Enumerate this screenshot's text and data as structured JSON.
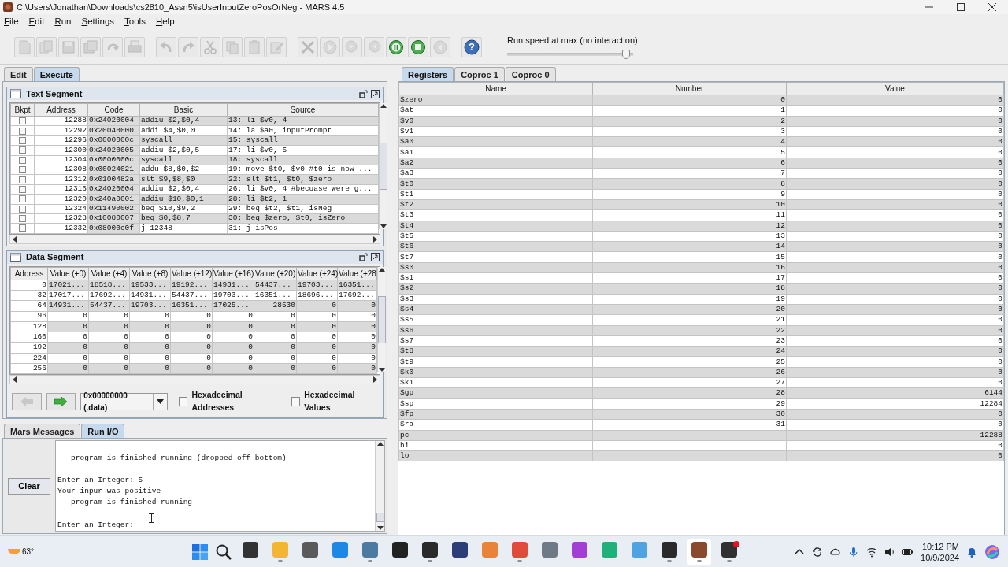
{
  "window": {
    "title": "C:\\Users\\Jonathan\\Downloads\\cs2810_Assn5\\isUserInputZeroPosOrNeg  - MARS 4.5"
  },
  "menu": [
    "File",
    "Edit",
    "Run",
    "Settings",
    "Tools",
    "Help"
  ],
  "toolbar": {
    "groups": [
      [
        {
          "kind": "new",
          "disabled": true
        },
        {
          "kind": "open",
          "disabled": true
        },
        {
          "kind": "save",
          "disabled": true
        },
        {
          "kind": "save_as",
          "disabled": true
        },
        {
          "kind": "dump",
          "disabled": true
        },
        {
          "kind": "print",
          "disabled": true
        }
      ],
      [
        {
          "kind": "undo",
          "disabled": true
        },
        {
          "kind": "redo",
          "disabled": true
        },
        {
          "kind": "cut",
          "disabled": true
        },
        {
          "kind": "copy",
          "disabled": true
        },
        {
          "kind": "paste",
          "disabled": true
        },
        {
          "kind": "find",
          "disabled": true
        }
      ],
      [
        {
          "kind": "assemble",
          "disabled": true
        },
        {
          "kind": "go",
          "disabled": true
        },
        {
          "kind": "step",
          "disabled": true
        },
        {
          "kind": "backstep",
          "disabled": true
        },
        {
          "kind": "pause",
          "disabled": false
        },
        {
          "kind": "stop",
          "disabled": false
        },
        {
          "kind": "reset",
          "disabled": true
        }
      ],
      [
        {
          "kind": "help",
          "disabled": false,
          "glyph": "?"
        }
      ]
    ],
    "speed": {
      "label": "Run speed at max (no interaction)",
      "level": 0.97
    }
  },
  "left_tabs": [
    {
      "label": "Edit",
      "selected": false
    },
    {
      "label": "Execute",
      "selected": true
    }
  ],
  "text_segment": {
    "title": "Text Segment",
    "columns": [
      "Bkpt",
      "Address",
      "Code",
      "Basic",
      "Source"
    ],
    "rows": [
      {
        "bkpt": false,
        "address": "12288",
        "code": "0x24020004",
        "basic": "addiu $2,$0,4",
        "source": "13: li $v0, 4"
      },
      {
        "bkpt": false,
        "address": "12292",
        "code": "0x20040000",
        "basic": "addi $4,$0,0",
        "source": "14: la $a0, inputPrompt"
      },
      {
        "bkpt": false,
        "address": "12296",
        "code": "0x0000000c",
        "basic": "syscall",
        "source": "15: syscall"
      },
      {
        "bkpt": false,
        "address": "12300",
        "code": "0x24020005",
        "basic": "addiu $2,$0,5",
        "source": "17: li $v0, 5"
      },
      {
        "bkpt": false,
        "address": "12304",
        "code": "0x0000000c",
        "basic": "syscall",
        "source": "18: syscall"
      },
      {
        "bkpt": false,
        "address": "12308",
        "code": "0x00024021",
        "basic": "addu $8,$0,$2",
        "source": "19: move $t0, $v0 #t0 is now ..."
      },
      {
        "bkpt": false,
        "address": "12312",
        "code": "0x0100482a",
        "basic": "slt $9,$8,$0",
        "source": "22: slt $t1, $t0, $zero"
      },
      {
        "bkpt": false,
        "address": "12316",
        "code": "0x24020004",
        "basic": "addiu $2,$0,4",
        "source": "26: li $v0, 4 #becuase were g..."
      },
      {
        "bkpt": false,
        "address": "12320",
        "code": "0x240a0001",
        "basic": "addiu $10,$0,1",
        "source": "28: li $t2, 1"
      },
      {
        "bkpt": false,
        "address": "12324",
        "code": "0x11490002",
        "basic": "beq $10,$9,2",
        "source": "29: beq $t2, $t1, isNeg"
      },
      {
        "bkpt": false,
        "address": "12328",
        "code": "0x10080007",
        "basic": "beq $0,$8,7",
        "source": "30: beq $zero, $t0, isZero"
      },
      {
        "bkpt": false,
        "address": "12332",
        "code": "0x08000c0f",
        "basic": "j 12348",
        "source": "31: j isPos"
      }
    ]
  },
  "data_segment": {
    "title": "Data Segment",
    "columns": [
      "Address",
      "Value (+0)",
      "Value (+4)",
      "Value (+8)",
      "Value (+12)",
      "Value (+16)",
      "Value (+20)",
      "Value (+24)",
      "Value (+28"
    ],
    "rows": [
      {
        "address": "0",
        "values": [
          "17021...",
          "18518...",
          "19533...",
          "19192...",
          "14931...",
          "54437...",
          "19703...",
          "16351..."
        ]
      },
      {
        "address": "32",
        "values": [
          "17017...",
          "17692...",
          "14931...",
          "54437...",
          "19703...",
          "16351...",
          "18696...",
          "17692..."
        ]
      },
      {
        "address": "64",
        "values": [
          "14931...",
          "54437...",
          "19703...",
          "16351...",
          "17025...",
          "28530",
          "0",
          "0"
        ]
      },
      {
        "address": "96",
        "values": [
          "0",
          "0",
          "0",
          "0",
          "0",
          "0",
          "0",
          "0"
        ]
      },
      {
        "address": "128",
        "values": [
          "0",
          "0",
          "0",
          "0",
          "0",
          "0",
          "0",
          "0"
        ]
      },
      {
        "address": "160",
        "values": [
          "0",
          "0",
          "0",
          "0",
          "0",
          "0",
          "0",
          "0"
        ]
      },
      {
        "address": "192",
        "values": [
          "0",
          "0",
          "0",
          "0",
          "0",
          "0",
          "0",
          "0"
        ]
      },
      {
        "address": "224",
        "values": [
          "0",
          "0",
          "0",
          "0",
          "0",
          "0",
          "0",
          "0"
        ]
      },
      {
        "address": "256",
        "values": [
          "0",
          "0",
          "0",
          "0",
          "0",
          "0",
          "0",
          "0"
        ]
      }
    ],
    "back_disabled": true,
    "forward_disabled": false,
    "address_select": "0x00000000 (.data)",
    "options": [
      {
        "label": "Hexadecimal Addresses",
        "checked": false
      },
      {
        "label": "Hexadecimal Values",
        "checked": false
      }
    ]
  },
  "messages": {
    "tabs": [
      {
        "label": "Mars Messages",
        "selected": false
      },
      {
        "label": "Run I/O",
        "selected": true
      }
    ],
    "clear_button": "Clear",
    "output": "\n-- program is finished running (dropped off bottom) --\n\nEnter an Integer: 5\nYour inpur was positive\n-- program is finished running --\n\nEnter an Integer: "
  },
  "registers": {
    "tabs": [
      {
        "label": "Registers",
        "selected": true
      },
      {
        "label": "Coproc 1",
        "selected": false
      },
      {
        "label": "Coproc 0",
        "selected": false
      }
    ],
    "columns": [
      "Name",
      "Number",
      "Value"
    ],
    "rows": [
      {
        "name": "$zero",
        "number": "0",
        "value": "0"
      },
      {
        "name": "$at",
        "number": "1",
        "value": "0"
      },
      {
        "name": "$v0",
        "number": "2",
        "value": "0"
      },
      {
        "name": "$v1",
        "number": "3",
        "value": "0"
      },
      {
        "name": "$a0",
        "number": "4",
        "value": "0"
      },
      {
        "name": "$a1",
        "number": "5",
        "value": "0"
      },
      {
        "name": "$a2",
        "number": "6",
        "value": "0"
      },
      {
        "name": "$a3",
        "number": "7",
        "value": "0"
      },
      {
        "name": "$t0",
        "number": "8",
        "value": "0"
      },
      {
        "name": "$t1",
        "number": "9",
        "value": "0"
      },
      {
        "name": "$t2",
        "number": "10",
        "value": "0"
      },
      {
        "name": "$t3",
        "number": "11",
        "value": "0"
      },
      {
        "name": "$t4",
        "number": "12",
        "value": "0"
      },
      {
        "name": "$t5",
        "number": "13",
        "value": "0"
      },
      {
        "name": "$t6",
        "number": "14",
        "value": "0"
      },
      {
        "name": "$t7",
        "number": "15",
        "value": "0"
      },
      {
        "name": "$s0",
        "number": "16",
        "value": "0"
      },
      {
        "name": "$s1",
        "number": "17",
        "value": "0"
      },
      {
        "name": "$s2",
        "number": "18",
        "value": "0"
      },
      {
        "name": "$s3",
        "number": "19",
        "value": "0"
      },
      {
        "name": "$s4",
        "number": "20",
        "value": "0"
      },
      {
        "name": "$s5",
        "number": "21",
        "value": "0"
      },
      {
        "name": "$s6",
        "number": "22",
        "value": "0"
      },
      {
        "name": "$s7",
        "number": "23",
        "value": "0"
      },
      {
        "name": "$t8",
        "number": "24",
        "value": "0"
      },
      {
        "name": "$t9",
        "number": "25",
        "value": "0"
      },
      {
        "name": "$k0",
        "number": "26",
        "value": "0"
      },
      {
        "name": "$k1",
        "number": "27",
        "value": "0"
      },
      {
        "name": "$gp",
        "number": "28",
        "value": "6144"
      },
      {
        "name": "$sp",
        "number": "29",
        "value": "12284"
      },
      {
        "name": "$fp",
        "number": "30",
        "value": "0"
      },
      {
        "name": "$ra",
        "number": "31",
        "value": "0"
      },
      {
        "name": "pc",
        "value": "12288"
      },
      {
        "name": "hi",
        "value": "0"
      },
      {
        "name": "lo",
        "value": "0"
      }
    ]
  },
  "taskbar": {
    "weather": "63°",
    "apps": [
      {
        "color": "#333333",
        "active": false,
        "running": false,
        "badge": false
      },
      {
        "color": "#f2b632",
        "active": false,
        "running": true,
        "badge": false
      },
      {
        "color": "#5a5a5a",
        "active": false,
        "running": false,
        "badge": false
      },
      {
        "color": "#1e88e5",
        "active": false,
        "running": false,
        "badge": false
      },
      {
        "color": "#4d7aa0",
        "active": false,
        "running": true,
        "badge": false
      },
      {
        "color": "#222222",
        "active": false,
        "running": false,
        "badge": false
      },
      {
        "color": "#2a2a2a",
        "active": false,
        "running": true,
        "badge": false
      },
      {
        "color": "#2c3e78",
        "active": false,
        "running": false,
        "badge": false
      },
      {
        "color": "#e8843a",
        "active": false,
        "running": false,
        "badge": false
      },
      {
        "color": "#e04a3a",
        "active": false,
        "running": true,
        "badge": false
      },
      {
        "color": "#6e7a86",
        "active": false,
        "running": false,
        "badge": false
      },
      {
        "color": "#a43fd6",
        "active": false,
        "running": false,
        "badge": false
      },
      {
        "color": "#21b07a",
        "active": false,
        "running": false,
        "badge": false
      },
      {
        "color": "#4fa3e0",
        "active": false,
        "running": false,
        "badge": false
      },
      {
        "color": "#2b2b2b",
        "active": false,
        "running": true,
        "badge": false
      },
      {
        "color": "#8a4a2e",
        "active": true,
        "running": true,
        "badge": false
      },
      {
        "color": "#303030",
        "active": false,
        "running": true,
        "badge": true
      }
    ],
    "time": "10:12 PM",
    "date": "10/9/2024"
  }
}
